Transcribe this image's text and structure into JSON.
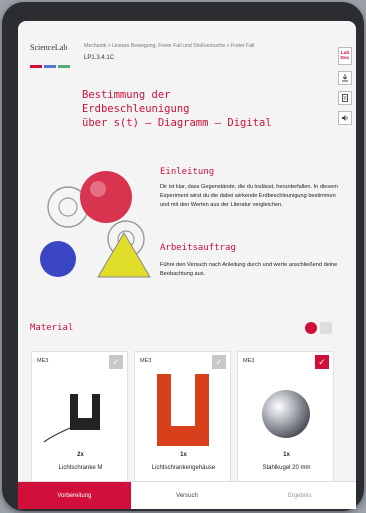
{
  "header": {
    "logo": "ScienceLab",
    "breadcrumb": "Mechanik  >  Lineare Bewegung, Freier Fall und Stoßversuche  >  Freier Fall",
    "code": "LP1.3.4.1C",
    "flag_colors": [
      "#d0103a",
      "#5577cc",
      "#55aa77"
    ]
  },
  "toolbar": {
    "labdoc_line1": "Lab",
    "labdoc_line2": "Doc",
    "download_icon": "download-icon",
    "document_icon": "document-icon",
    "audio_icon": "speaker-icon"
  },
  "title": {
    "line1": "Bestimmung der Erdbeschleunigung",
    "line2": "über s(t) – Diagramm – Digital"
  },
  "intro": {
    "heading": "Einleitung",
    "text": "Dir ist klar, dass Gegenstände, die du loslässt, herunterfallen. In diesem Experiment wirst du die dabei wirkende Erdbeschleunigung bestimmen und mit den Werten aus der Literatur vergleichen."
  },
  "task": {
    "heading": "Arbeitsauftrag",
    "text": "Führe den Versuch nach Anleitung durch und werte anschließend deine Beobachtung aus."
  },
  "material": {
    "heading": "Material",
    "items": [
      {
        "code": "ME3",
        "qty": "2x",
        "name": "Lichtschranke M",
        "checked": false
      },
      {
        "code": "ME3",
        "qty": "1x",
        "name": "Lichtschrankengehäuse",
        "checked": false
      },
      {
        "code": "ME3",
        "qty": "1x",
        "name": "Stahlkugel 20 mm",
        "checked": true
      }
    ]
  },
  "tabs": {
    "prep": "Vorbereitung",
    "experiment": "Versuch",
    "results": "Ergebnis"
  },
  "colors": {
    "accent": "#d0103a",
    "background": "#f4f4f4"
  }
}
